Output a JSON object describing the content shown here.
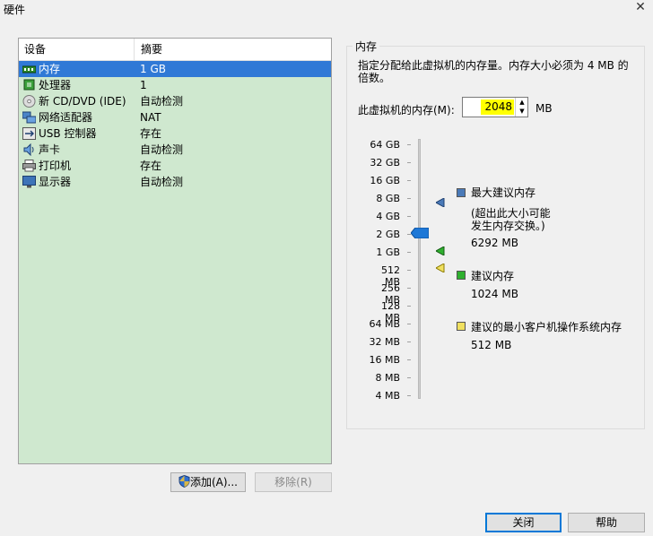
{
  "window": {
    "title": "硬件",
    "close_glyph": "✕"
  },
  "device_list": {
    "columns": [
      "设备",
      "摘要"
    ],
    "rows": [
      {
        "name": "内存",
        "summary": "1 GB",
        "icon": "memory-icon",
        "selected": true
      },
      {
        "name": "处理器",
        "summary": "1",
        "icon": "processor-icon",
        "selected": false
      },
      {
        "name": "新 CD/DVD (IDE)",
        "summary": "自动检测",
        "icon": "cd-dvd-icon",
        "selected": false
      },
      {
        "name": "网络适配器",
        "summary": "NAT",
        "icon": "network-adapter-icon",
        "selected": false
      },
      {
        "name": "USB 控制器",
        "summary": "存在",
        "icon": "usb-icon",
        "selected": false
      },
      {
        "name": "声卡",
        "summary": "自动检测",
        "icon": "sound-card-icon",
        "selected": false
      },
      {
        "name": "打印机",
        "summary": "存在",
        "icon": "printer-icon",
        "selected": false
      },
      {
        "name": "显示器",
        "summary": "自动检测",
        "icon": "display-icon",
        "selected": false
      }
    ],
    "background_color": "#cfe8cf",
    "selection_color": "#3079d6"
  },
  "buttons": {
    "add": "添加(A)...",
    "remove": "移除(R)",
    "ok": "关闭",
    "help": "帮助"
  },
  "memory": {
    "group_title": "内存",
    "description": "指定分配给此虚拟机的内存量。内存大小必须为 4 MB 的倍数。",
    "field_label": "此虚拟机的内存(M):",
    "value": "2048",
    "unit": "MB",
    "highlight_color": "#ffff00",
    "scale_labels": [
      "64 GB",
      "32 GB",
      "16 GB",
      "8 GB",
      "4 GB",
      "2 GB",
      "1 GB",
      "512 MB",
      "256 MB",
      "128 MB",
      "64 MB",
      "32 MB",
      "16 MB",
      "8 MB",
      "4 MB"
    ],
    "legend": {
      "max_title": "最大建议内存",
      "max_note_line1": "(超出此大小可能",
      "max_note_line2": "发生内存交换。)",
      "max_value": "6292 MB",
      "rec_title": "建议内存",
      "rec_value": "1024 MB",
      "min_title": "建议的最小客户机操作系统内存",
      "min_value": "512 MB",
      "colors": {
        "max": "#4a7ab8",
        "recommended": "#2fb02f",
        "minimum": "#f0e060"
      }
    }
  }
}
